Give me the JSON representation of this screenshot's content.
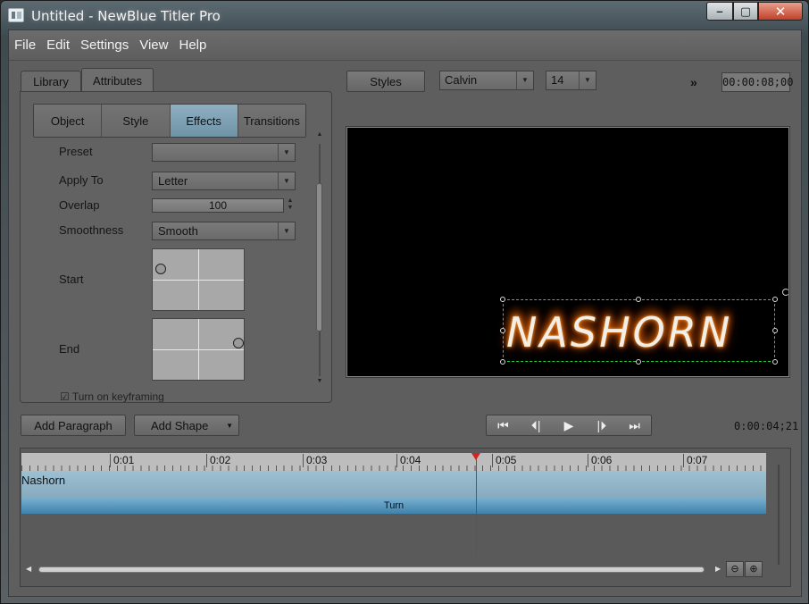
{
  "window": {
    "title": "Untitled - NewBlue Titler Pro",
    "controls": [
      "–",
      "▢",
      "✕"
    ]
  },
  "menu": [
    "File",
    "Edit",
    "Settings",
    "View",
    "Help"
  ],
  "left_tabs": {
    "library": "Library",
    "attributes": "Attributes"
  },
  "subtabs": [
    "Object",
    "Style",
    "Effects",
    "Transitions"
  ],
  "active_subtab": "Effects",
  "properties": {
    "preset_label": "Preset",
    "preset_value": "",
    "apply_to_label": "Apply To",
    "apply_to_value": "Letter",
    "overlap_label": "Overlap",
    "overlap_value": "100",
    "smoothness_label": "Smoothness",
    "smoothness_value": "Smooth",
    "start_label": "Start",
    "end_label": "End",
    "keyframing_label": "Turn on keyframing"
  },
  "toolbar": {
    "styles_label": "Styles",
    "font": "Calvin",
    "font_size": "14",
    "more": "»",
    "duration": "00:00:08;00"
  },
  "preview": {
    "text": "NASHORN",
    "accent": "#27d13a"
  },
  "bottom": {
    "add_paragraph": "Add Paragraph",
    "add_shape": "Add Shape",
    "current_time": "0:00:04;21"
  },
  "timeline": {
    "ticks": [
      "0:01",
      "0:02",
      "0:03",
      "0:04",
      "0:05",
      "0:06",
      "0:07"
    ],
    "track_label": "Nashorn",
    "effect_label": "Turn"
  }
}
